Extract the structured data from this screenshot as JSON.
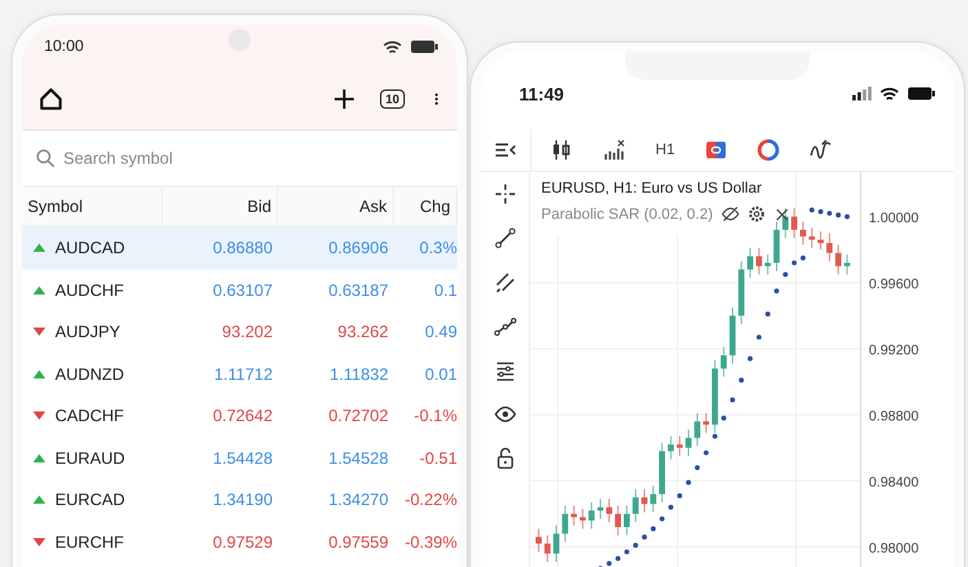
{
  "watchlist_phone": {
    "status_bar": {
      "time": "10:00"
    },
    "toolbar": {
      "badge": "10"
    },
    "search": {
      "placeholder": "Search symbol"
    },
    "table": {
      "columns": [
        "Symbol",
        "Bid",
        "Ask",
        "Chg"
      ],
      "rows": [
        {
          "symbol": "AUDCAD",
          "bid": "0.86880",
          "ask": "0.86906",
          "change": "0.3%",
          "rising": true,
          "change_negative": false,
          "selected": true
        },
        {
          "symbol": "AUDCHF",
          "bid": "0.63107",
          "ask": "0.63187",
          "change": "0.1",
          "rising": true,
          "change_negative": false,
          "selected": false
        },
        {
          "symbol": "AUDJPY",
          "bid": "93.202",
          "ask": "93.262",
          "change": "0.49",
          "rising": false,
          "change_negative": false,
          "selected": false
        },
        {
          "symbol": "AUDNZD",
          "bid": "1.11712",
          "ask": "1.11832",
          "change": "0.01",
          "rising": true,
          "change_negative": false,
          "selected": false
        },
        {
          "symbol": "CADCHF",
          "bid": "0.72642",
          "ask": "0.72702",
          "change": "-0.1%",
          "rising": false,
          "change_negative": true,
          "selected": false
        },
        {
          "symbol": "EURAUD",
          "bid": "1.54428",
          "ask": "1.54528",
          "change": "-0.51",
          "rising": true,
          "change_negative": true,
          "selected": false
        },
        {
          "symbol": "EURCAD",
          "bid": "1.34190",
          "ask": "1.34270",
          "change": "-0.22%",
          "rising": true,
          "change_negative": true,
          "selected": false
        },
        {
          "symbol": "EURCHF",
          "bid": "0.97529",
          "ask": "0.97559",
          "change": "-0.39%",
          "rising": false,
          "change_negative": true,
          "selected": false
        }
      ]
    }
  },
  "chart_phone": {
    "status_bar": {
      "time": "11:49"
    },
    "toolbar": {
      "timeframe": "H1"
    },
    "chart": {
      "title": "EURUSD, H1: Euro vs US Dollar",
      "chart_data": {
        "type": "candlestick",
        "grid": true,
        "ylim": [
          0.9777,
          1.0027
        ],
        "yticks": [
          {
            "value": 1.0,
            "label": "1.00000"
          },
          {
            "value": 0.996,
            "label": "0.99600"
          },
          {
            "value": 0.992,
            "label": "0.99200"
          },
          {
            "value": 0.988,
            "label": "0.98800"
          },
          {
            "value": 0.984,
            "label": "0.98400"
          },
          {
            "value": 0.98,
            "label": "0.98000"
          }
        ],
        "ohlc": [
          [
            0.9806,
            0.9811,
            0.9797,
            0.9802
          ],
          [
            0.9802,
            0.9807,
            0.9791,
            0.9796
          ],
          [
            0.9796,
            0.9813,
            0.9791,
            0.9808
          ],
          [
            0.9808,
            0.9825,
            0.9803,
            0.982
          ],
          [
            0.982,
            0.9825,
            0.9813,
            0.9818
          ],
          [
            0.9818,
            0.9823,
            0.9811,
            0.9816
          ],
          [
            0.9816,
            0.9827,
            0.9811,
            0.9822
          ],
          [
            0.9822,
            0.9829,
            0.9817,
            0.9824
          ],
          [
            0.9824,
            0.9829,
            0.9815,
            0.982
          ],
          [
            0.982,
            0.9825,
            0.9807,
            0.9812
          ],
          [
            0.9812,
            0.9825,
            0.9807,
            0.982
          ],
          [
            0.982,
            0.9835,
            0.9815,
            0.983
          ],
          [
            0.983,
            0.9835,
            0.9821,
            0.9826
          ],
          [
            0.9826,
            0.9837,
            0.9821,
            0.9832
          ],
          [
            0.9832,
            0.9863,
            0.9827,
            0.9858
          ],
          [
            0.9858,
            0.9867,
            0.9853,
            0.9862
          ],
          [
            0.9862,
            0.9867,
            0.9855,
            0.986
          ],
          [
            0.986,
            0.9871,
            0.9855,
            0.9866
          ],
          [
            0.9866,
            0.9881,
            0.9861,
            0.9876
          ],
          [
            0.9876,
            0.9881,
            0.9869,
            0.9874
          ],
          [
            0.9874,
            0.9913,
            0.9869,
            0.9908
          ],
          [
            0.9908,
            0.9921,
            0.9903,
            0.9916
          ],
          [
            0.9916,
            0.9945,
            0.9911,
            0.994
          ],
          [
            0.994,
            0.9973,
            0.9935,
            0.9968
          ],
          [
            0.9968,
            0.9981,
            0.9963,
            0.9976
          ],
          [
            0.9976,
            0.9981,
            0.9965,
            0.997
          ],
          [
            0.997,
            0.9977,
            0.9965,
            0.9972
          ],
          [
            0.9972,
            0.9997,
            0.9967,
            0.9992
          ],
          [
            0.9992,
            1.0005,
            0.9987,
            1.0
          ],
          [
            1.0,
            1.0005,
            0.9987,
            0.9992
          ],
          [
            0.9992,
            0.9997,
            0.9983,
            0.9988
          ],
          [
            0.9988,
            0.9993,
            0.9981,
            0.9986
          ],
          [
            0.9986,
            0.9991,
            0.998,
            0.9984
          ],
          [
            0.9984,
            0.999,
            0.9973,
            0.9978
          ],
          [
            0.9978,
            0.9983,
            0.9965,
            0.997
          ],
          [
            0.997,
            0.9977,
            0.9965,
            0.9972
          ]
        ],
        "series": [
          {
            "name": "Parabolic SAR (0.02, 0.2)",
            "type": "scatter",
            "color": "#2a4fa8",
            "values": [
              null,
              null,
              null,
              null,
              null,
              null,
              null,
              0.9787,
              0.979,
              0.9793,
              0.9797,
              0.9801,
              0.9806,
              0.9811,
              0.9817,
              0.9824,
              0.9831,
              0.9839,
              0.9848,
              0.9857,
              0.9867,
              0.9878,
              0.9889,
              0.9901,
              0.9914,
              0.9927,
              0.9941,
              0.9955,
              0.9965,
              0.9972,
              0.9975,
              1.0004,
              1.0003,
              1.0002,
              1.0001,
              1.0
            ]
          }
        ]
      }
    }
  }
}
